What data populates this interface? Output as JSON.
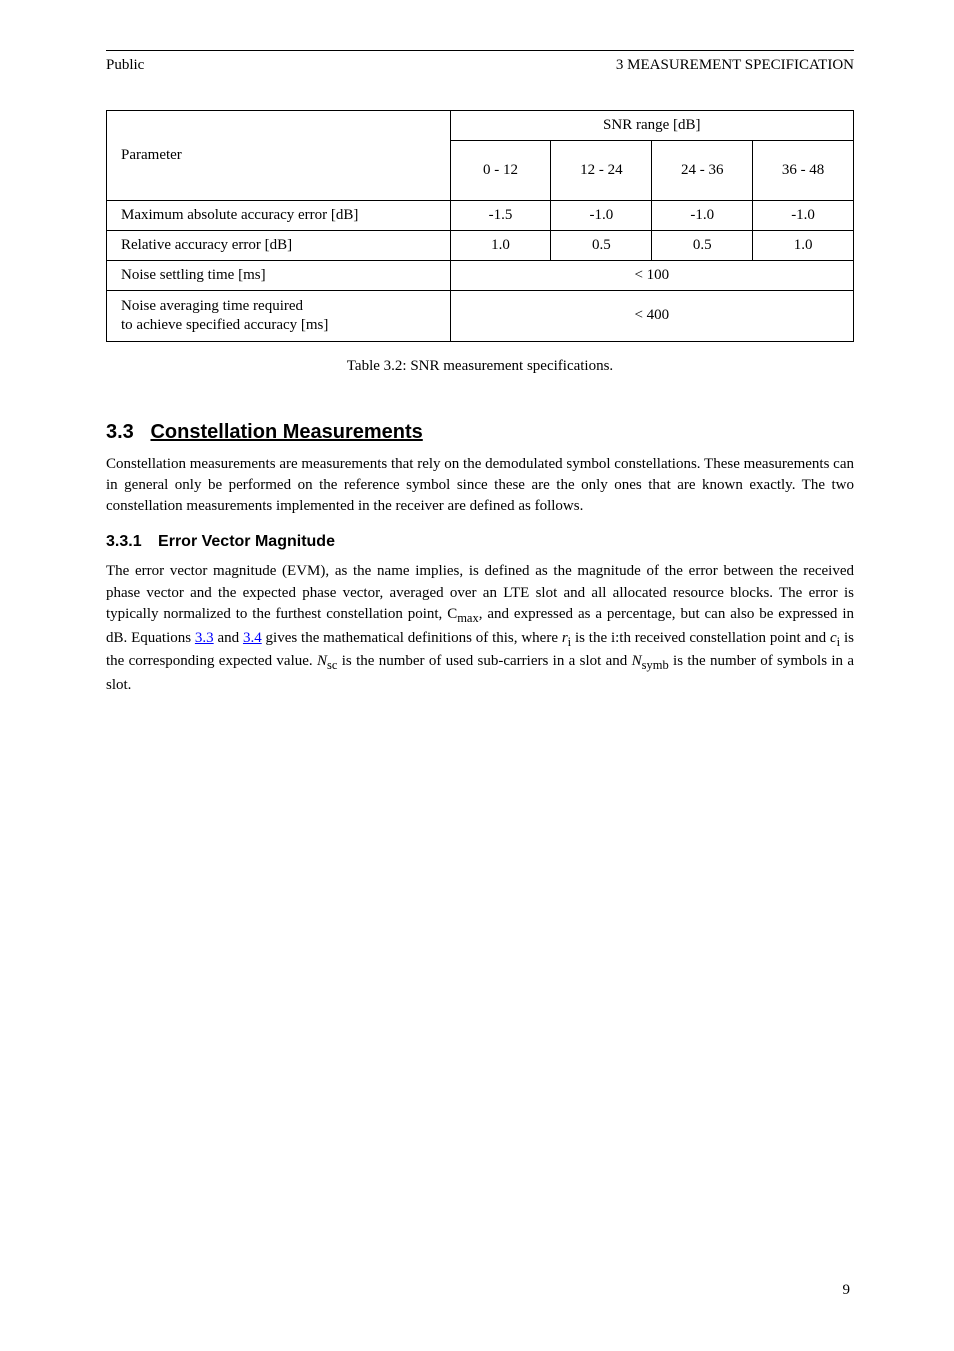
{
  "header": {
    "left": "Public",
    "right": "3 MEASUREMENT SPECIFICATION"
  },
  "spec_table": {
    "header_top": "SNR range [dB]",
    "param_label": "Parameter",
    "cols": [
      "0 - 12",
      "12 - 24",
      "24 - 36",
      "36 - 48"
    ],
    "rows": [
      {
        "label": "Maximum absolute accuracy error [dB]",
        "values": [
          "-1.5",
          "-1.0",
          "-1.0",
          "-1.0"
        ]
      },
      {
        "label": "Relative accuracy error [dB]",
        "values": [
          "1.0",
          "0.5",
          "0.5",
          "1.0"
        ]
      }
    ],
    "rows_merged": [
      {
        "label": "Noise settling time [ms]",
        "value": "< 100"
      },
      {
        "label_lines": [
          "Noise averaging time required",
          "to achieve specified accuracy [ms]"
        ],
        "value": "< 400"
      }
    ]
  },
  "table_caption": "Table 3.2: SNR measurement specifications.",
  "section": {
    "number": "3.3",
    "title": "Constellation Measurements",
    "intro": "Constellation measurements are measurements that rely on the demodulated symbol constellations. These measurements can in general only be performed on the reference symbol since these are the only ones that are known exactly. The two constellation measurements implemented in the receiver are defined as follows."
  },
  "subsection": {
    "number": "3.3.1",
    "title": "Error Vector Magnitude",
    "intro_parts": {
      "before_link": "The error vector magnitude (EVM), as the name implies, is defined as the magnitude of the error between the received phase vector and the expected phase vector, averaged over an LTE slot and all allocated resource blocks. The error is typically normalized to the furthest constellation point, C",
      "sub1": "max",
      "mid1": ", and expressed as a percentage, but can also be expressed in dB. Equations ",
      "link1_text": "3.3",
      "mid2": " and ",
      "link2_text": "3.4",
      "mid3": " gives the mathematical definitions of this, where ",
      "var1": "r",
      "var1_sub": "i",
      "mid4": " is the i:th received constellation point and ",
      "var2": "c",
      "var2_sub": "i",
      "mid5": " is the corresponding expected value. ",
      "var3": "N",
      "var3_sub": "sc",
      "mid6": " is the number of used sub-carriers in a slot and ",
      "var4": "N",
      "var4_sub": "symb",
      "after": " is the number of symbols in a slot."
    }
  },
  "page_number": "9"
}
